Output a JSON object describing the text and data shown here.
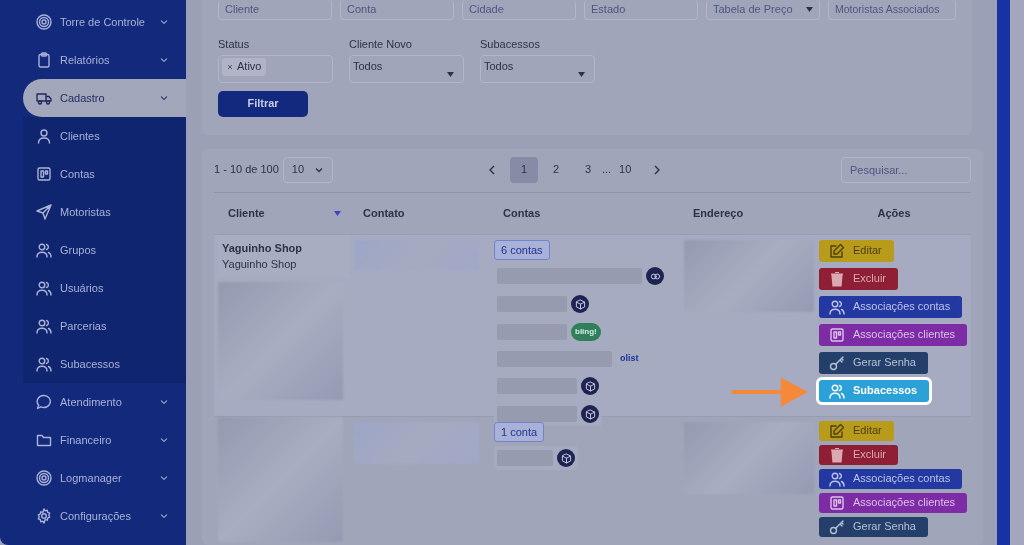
{
  "sidebar": {
    "items": [
      {
        "label": "Torre de Controle",
        "selected": false
      },
      {
        "label": "Relatórios",
        "selected": false
      },
      {
        "label": "Cadastro",
        "selected": true,
        "expanded": true,
        "children": [
          {
            "label": "Clientes"
          },
          {
            "label": "Contas"
          },
          {
            "label": "Motoristas"
          },
          {
            "label": "Grupos"
          },
          {
            "label": "Usuários"
          },
          {
            "label": "Parcerias"
          },
          {
            "label": "Subacessos"
          }
        ]
      },
      {
        "label": "Atendimento",
        "selected": false
      },
      {
        "label": "Financeiro",
        "selected": false
      },
      {
        "label": "Logmanager",
        "selected": false
      },
      {
        "label": "Configurações",
        "selected": false
      }
    ]
  },
  "filters": {
    "fields": [
      {
        "kind": "text",
        "placeholder": "Cliente"
      },
      {
        "kind": "text",
        "placeholder": "Conta"
      },
      {
        "kind": "text",
        "placeholder": "Cidade"
      },
      {
        "kind": "text",
        "placeholder": "Estado"
      },
      {
        "kind": "select",
        "placeholder": "Tabela de Preço"
      },
      {
        "kind": "text",
        "placeholder": "Motoristas Associados"
      }
    ],
    "selects": [
      {
        "kind": "tags",
        "label": "Status",
        "tags": [
          "Ativo"
        ]
      },
      {
        "kind": "select",
        "label": "Cliente Novo",
        "value": "Todos"
      },
      {
        "kind": "select",
        "label": "Subacessos",
        "value": "Todos"
      }
    ],
    "submit": "Filtrar"
  },
  "table": {
    "range": "1 - 10 de 100",
    "page_size": "10",
    "pages": [
      {
        "kind": "page",
        "label": "1",
        "selected": true
      },
      {
        "kind": "page",
        "label": "2",
        "selected": false
      },
      {
        "kind": "page",
        "label": "3",
        "selected": false
      },
      {
        "kind": "ellipsis",
        "label": "..."
      },
      {
        "kind": "page",
        "label": "10",
        "selected": false
      }
    ],
    "search": {
      "placeholder": "Pesquisar..."
    },
    "columns": [
      {
        "label": "Cliente",
        "sorted": true
      },
      {
        "label": "Contato",
        "sorted": false
      },
      {
        "label": "Contas",
        "sorted": false
      },
      {
        "label": "Endereço",
        "sorted": false
      },
      {
        "label": "Ações",
        "sorted": false
      }
    ],
    "rows": [
      {
        "name": "Yaguinho Shop",
        "subname": "Yaguinho Shop",
        "accounts_badge": "6 contas",
        "accounts": [
          {
            "kind": "link"
          },
          {
            "kind": "box"
          },
          {
            "kind": "bling",
            "logo": "bling!"
          },
          {
            "kind": "olist",
            "logo": "olist"
          },
          {
            "kind": "box"
          },
          {
            "kind": "box"
          }
        ],
        "actions": [
          {
            "kind": "edit",
            "label": "Editar",
            "highlighted": false
          },
          {
            "kind": "delete",
            "label": "Excluir",
            "highlighted": false
          },
          {
            "kind": "accounts",
            "label": "Associações contas",
            "highlighted": false
          },
          {
            "kind": "clients",
            "label": "Associações clientes",
            "highlighted": false
          },
          {
            "kind": "password",
            "label": "Gerar Senha",
            "highlighted": false
          },
          {
            "kind": "subaccess",
            "label": "Subacessos",
            "highlighted": true
          }
        ]
      },
      {
        "accounts_badge": "1 conta",
        "accounts": [
          {
            "kind": "box"
          }
        ],
        "actions": [
          {
            "kind": "edit",
            "label": "Editar",
            "highlighted": false
          },
          {
            "kind": "delete",
            "label": "Excluir",
            "highlighted": false
          },
          {
            "kind": "accounts",
            "label": "Associações contas",
            "highlighted": false
          },
          {
            "kind": "clients",
            "label": "Associações clientes",
            "highlighted": false
          },
          {
            "kind": "password",
            "label": "Gerar Senha",
            "highlighted": false
          }
        ]
      }
    ]
  }
}
